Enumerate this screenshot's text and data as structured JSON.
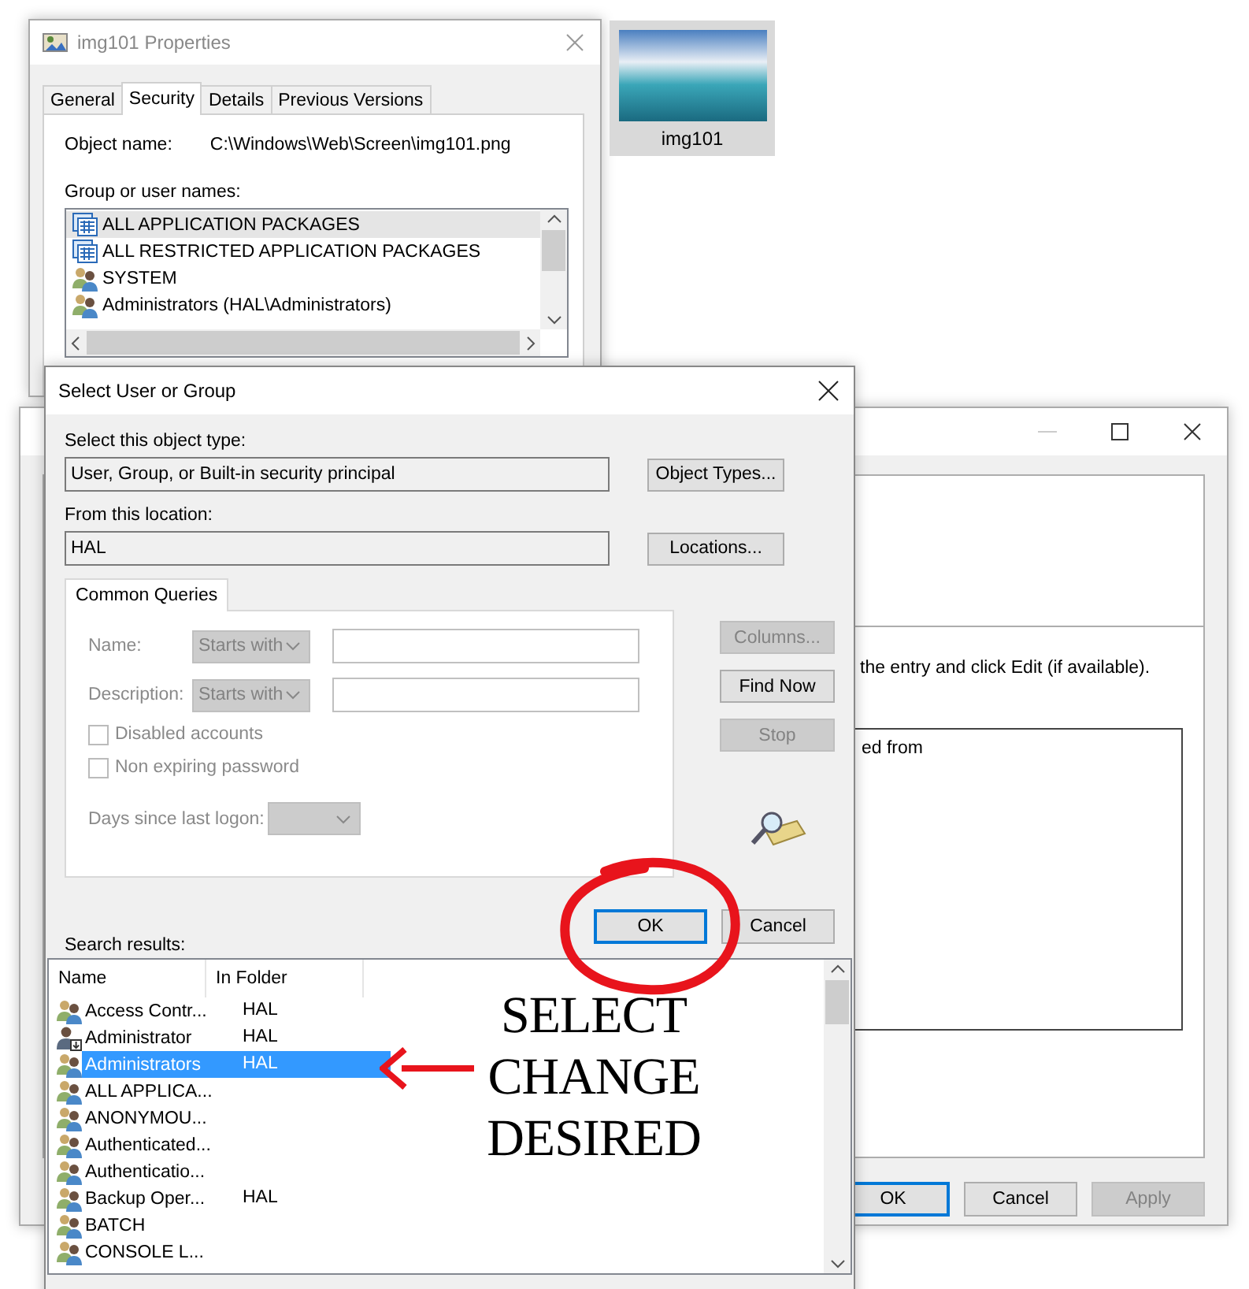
{
  "properties_window": {
    "title": "img101 Properties",
    "tabs": [
      {
        "label": "General",
        "selected": false
      },
      {
        "label": "Security",
        "selected": true
      },
      {
        "label": "Details",
        "selected": false
      },
      {
        "label": "Previous Versions",
        "selected": false
      }
    ],
    "object_name_label": "Object name:",
    "object_name": "C:\\Windows\\Web\\Screen\\img101.png",
    "names_label": "Group or user names:",
    "names": [
      {
        "name": "ALL APPLICATION PACKAGES",
        "kind": "package",
        "selected": true
      },
      {
        "name": "ALL RESTRICTED APPLICATION PACKAGES",
        "kind": "package",
        "selected": false
      },
      {
        "name": "SYSTEM",
        "kind": "group",
        "selected": false
      },
      {
        "name": "Administrators (HAL\\Administrators)",
        "kind": "group",
        "selected": false
      }
    ]
  },
  "desktop_file": {
    "name": "img101",
    "selected": true
  },
  "advanced_window": {
    "instruction": "the entry and click Edit (if available).",
    "list_text": "ed from",
    "buttons": [
      {
        "label": "OK",
        "disabled": false,
        "default": true
      },
      {
        "label": "Cancel",
        "disabled": false,
        "default": false
      },
      {
        "label": "Apply",
        "disabled": true,
        "default": false
      }
    ]
  },
  "select_dialog": {
    "title": "Select User or Group",
    "object_type_label": "Select this object type:",
    "object_type": "User, Group, or Built-in security principal",
    "object_types_button": "Object Types...",
    "location_label": "From this location:",
    "location": "HAL",
    "locations_button": "Locations...",
    "query_tab": {
      "label": "Common Queries",
      "selected": true
    },
    "queries_disabled": true,
    "name_label": "Name:",
    "name_mode": "Starts with",
    "description_label": "Description:",
    "description_mode": "Starts with",
    "checkboxes": [
      {
        "label": "Disabled accounts",
        "checked": false
      },
      {
        "label": "Non expiring password",
        "checked": false
      }
    ],
    "days_label": "Days since last logon:",
    "side_buttons": [
      {
        "label": "Columns...",
        "disabled": true
      },
      {
        "label": "Find Now",
        "disabled": false
      },
      {
        "label": "Stop",
        "disabled": true
      }
    ],
    "ok_button": {
      "label": "OK",
      "focused": true
    },
    "cancel_button": "Cancel",
    "results_label": "Search results:",
    "columns": [
      "Name",
      "In Folder"
    ],
    "results": [
      {
        "name": "Access Contr...",
        "folder": "HAL",
        "kind": "group",
        "selected": false
      },
      {
        "name": "Administrator",
        "folder": "HAL",
        "kind": "user",
        "selected": false
      },
      {
        "name": "Administrators",
        "folder": "HAL",
        "kind": "group",
        "selected": true
      },
      {
        "name": "ALL APPLICA...",
        "kind": "group",
        "selected": false
      },
      {
        "name": "ANONYMOU...",
        "kind": "group",
        "selected": false
      },
      {
        "name": "Authenticated...",
        "kind": "group",
        "selected": false
      },
      {
        "name": "Authenticatio...",
        "kind": "group",
        "selected": false
      },
      {
        "name": "Backup Oper...",
        "folder": "HAL",
        "kind": "group",
        "selected": false
      },
      {
        "name": "BATCH",
        "kind": "group",
        "selected": false
      },
      {
        "name": "CONSOLE L...",
        "kind": "group",
        "selected": false
      }
    ]
  },
  "annotation": {
    "lines": [
      "SELECT",
      "CHANGE",
      "DESIRED"
    ]
  }
}
